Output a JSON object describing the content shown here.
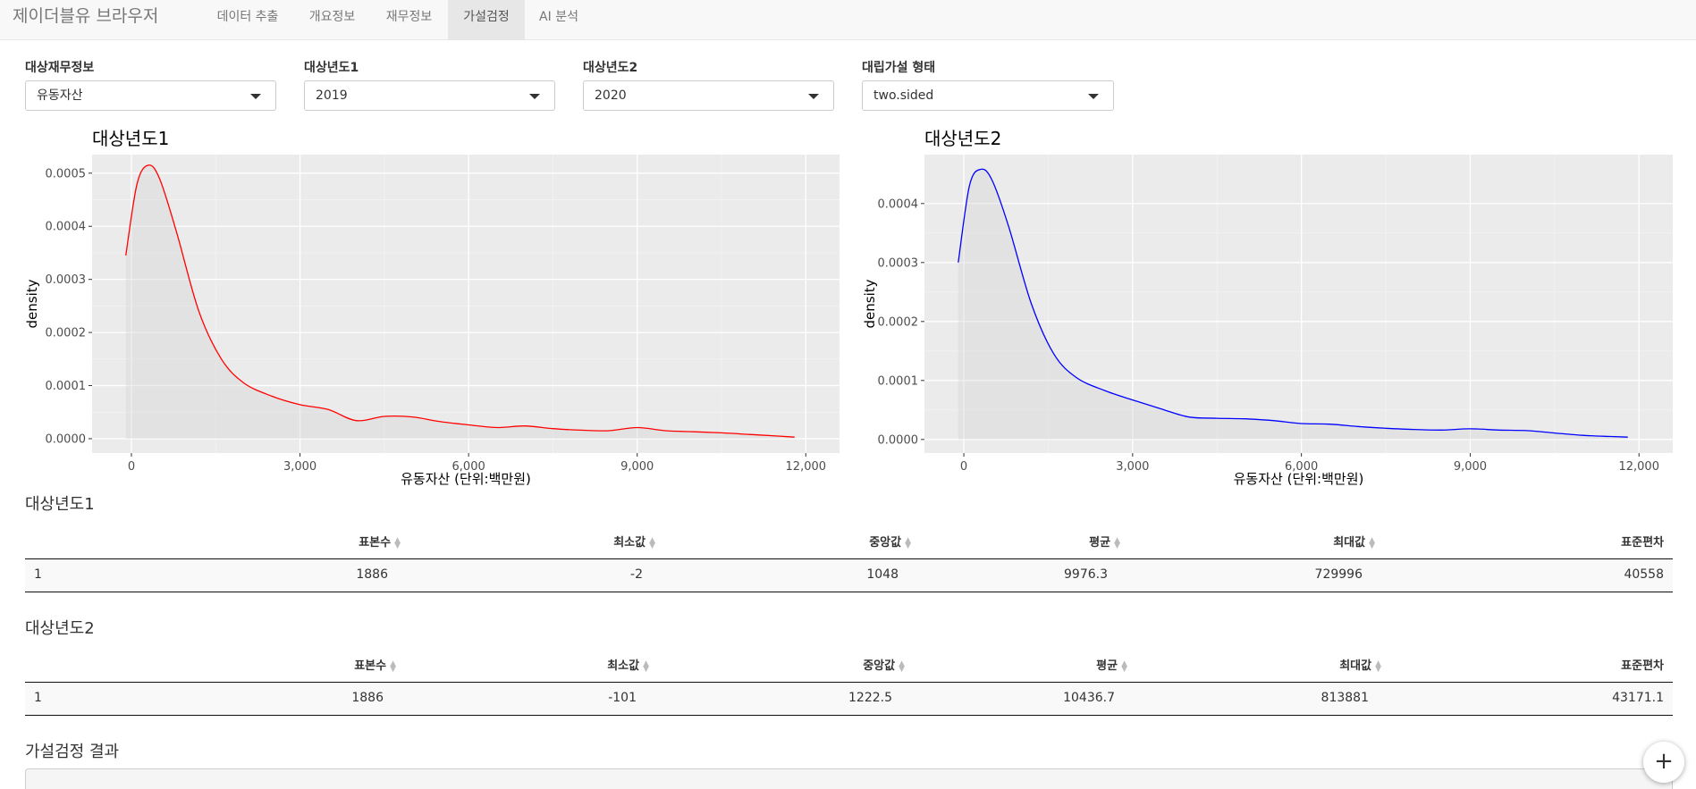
{
  "navbar": {
    "brand": "제이더블유 브라우저",
    "tabs": [
      {
        "label": "데이터 추출",
        "active": false
      },
      {
        "label": "개요정보",
        "active": false
      },
      {
        "label": "재무정보",
        "active": false
      },
      {
        "label": "가설검정",
        "active": true
      },
      {
        "label": "AI 분석",
        "active": false
      }
    ]
  },
  "inputs": {
    "finance_item": {
      "label": "대상재무정보",
      "value": "유동자산"
    },
    "year1": {
      "label": "대상년도1",
      "value": "2019"
    },
    "year2": {
      "label": "대상년도2",
      "value": "2020"
    },
    "alternative": {
      "label": "대립가설 형태",
      "value": "two.sided"
    }
  },
  "chart_data": [
    {
      "type": "area",
      "title": "대상년도1",
      "xlabel": "유동자산 (단위:백만원)",
      "ylabel": "density",
      "x_ticks": [
        "0",
        "3,000",
        "6,000",
        "9,000",
        "12,000"
      ],
      "y_ticks": [
        "0.0000",
        "0.0001",
        "0.0002",
        "0.0003",
        "0.0004",
        "0.0005"
      ],
      "xlim": [
        -700,
        12600
      ],
      "ylim": [
        -2.7e-05,
        0.000535
      ],
      "line_color": "#ff0000",
      "grid": true,
      "x": [
        -100,
        100,
        300,
        500,
        800,
        1200,
        1600,
        2000,
        2500,
        3000,
        3500,
        4000,
        4500,
        5000,
        5500,
        6000,
        6500,
        7000,
        7500,
        8000,
        8500,
        9000,
        9500,
        10000,
        10500,
        11000,
        11500,
        11800
      ],
      "values": [
        0.000345,
        0.00048,
        0.000515,
        0.00049,
        0.00039,
        0.00024,
        0.00015,
        0.000105,
        8e-05,
        6.4e-05,
        5.5e-05,
        3.4e-05,
        4.2e-05,
        4.1e-05,
        3.2e-05,
        2.6e-05,
        2.1e-05,
        2.4e-05,
        1.9e-05,
        1.6e-05,
        1.5e-05,
        2.1e-05,
        1.5e-05,
        1.3e-05,
        1.1e-05,
        8e-06,
        5e-06,
        3e-06
      ]
    },
    {
      "type": "area",
      "title": "대상년도2",
      "xlabel": "유동자산 (단위:백만원)",
      "ylabel": "density",
      "x_ticks": [
        "0",
        "3,000",
        "6,000",
        "9,000",
        "12,000"
      ],
      "y_ticks": [
        "0.0000",
        "0.0001",
        "0.0002",
        "0.0003",
        "0.0004"
      ],
      "xlim": [
        -700,
        12600
      ],
      "ylim": [
        -2.3e-05,
        0.000483
      ],
      "line_color": "#0000ff",
      "grid": true,
      "x": [
        -100,
        100,
        300,
        500,
        800,
        1200,
        1600,
        2000,
        2500,
        3000,
        3500,
        4000,
        4500,
        5000,
        5500,
        6000,
        6500,
        7000,
        7500,
        8000,
        8500,
        9000,
        9500,
        10000,
        10500,
        11000,
        11500,
        11800
      ],
      "values": [
        0.0003,
        0.00043,
        0.000458,
        0.00044,
        0.00036,
        0.00023,
        0.000145,
        0.000105,
        8.3e-05,
        6.7e-05,
        5.2e-05,
        3.8e-05,
        3.6e-05,
        3.5e-05,
        3.2e-05,
        2.7e-05,
        2.6e-05,
        2.2e-05,
        1.9e-05,
        1.7e-05,
        1.6e-05,
        1.8e-05,
        1.6e-05,
        1.5e-05,
        1.1e-05,
        7e-06,
        5e-06,
        4e-06
      ]
    }
  ],
  "table1": {
    "title": "대상년도1",
    "headers": [
      "표본수",
      "최소값",
      "중앙값",
      "평균",
      "최대값",
      "표준편차"
    ],
    "rows": [
      [
        "1",
        "1886",
        "-2",
        "1048",
        "9976.3",
        "729996",
        "40558"
      ]
    ]
  },
  "table2": {
    "title": "대상년도2",
    "headers": [
      "표본수",
      "최소값",
      "중앙값",
      "평균",
      "최대값",
      "표준편차"
    ],
    "rows": [
      [
        "1",
        "1886",
        "-101",
        "1222.5",
        "10436.7",
        "813881",
        "43171.1"
      ]
    ]
  },
  "result": {
    "title": "가설검정 결과"
  },
  "fab": {
    "label": "+"
  }
}
